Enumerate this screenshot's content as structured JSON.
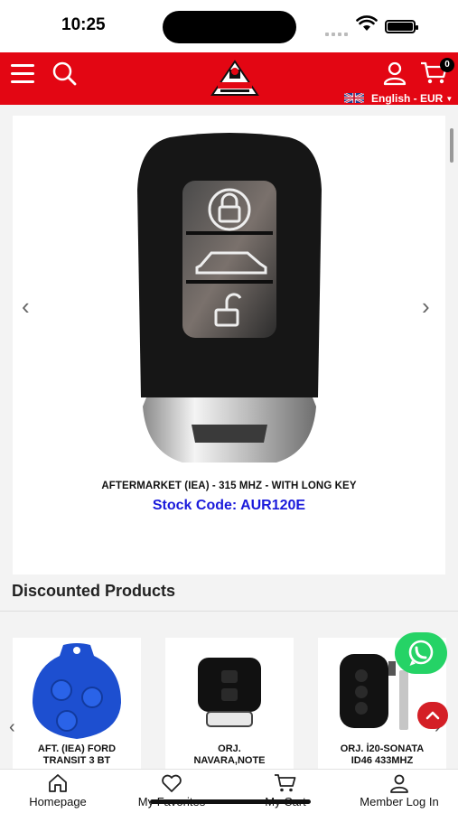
{
  "status_bar": {
    "time": "10:25"
  },
  "header": {
    "logo_text": "KEYSTORE",
    "cart_count": "0",
    "language": "English - EUR"
  },
  "featured": {
    "title": "AFTERMARKET (IEA) - 315 MHZ - WITH LONG KEY",
    "stock_code": "Stock Code: AUR120E"
  },
  "discounted": {
    "heading": "Discounted Products",
    "products": [
      {
        "name_line1": "AFT. (IEA) FORD",
        "name_line2": "TRANSIT 3 BT"
      },
      {
        "name_line1": "ORJ.",
        "name_line2": "NAVARA,NOTE"
      },
      {
        "name_line1": "ORJ. İ20-SONATA",
        "name_line2": "ID46 433MHZ"
      }
    ]
  },
  "bottom_nav": {
    "items": [
      {
        "label": "Homepage",
        "icon": "home-icon"
      },
      {
        "label": "My Favorites",
        "icon": "heart-icon"
      },
      {
        "label": "My Cart",
        "icon": "cart-icon"
      },
      {
        "label": "Member Log In",
        "icon": "user-icon"
      }
    ]
  },
  "colors": {
    "brand_red": "#e30613",
    "stock_blue": "#1a1adb",
    "whatsapp_green": "#25d366"
  }
}
